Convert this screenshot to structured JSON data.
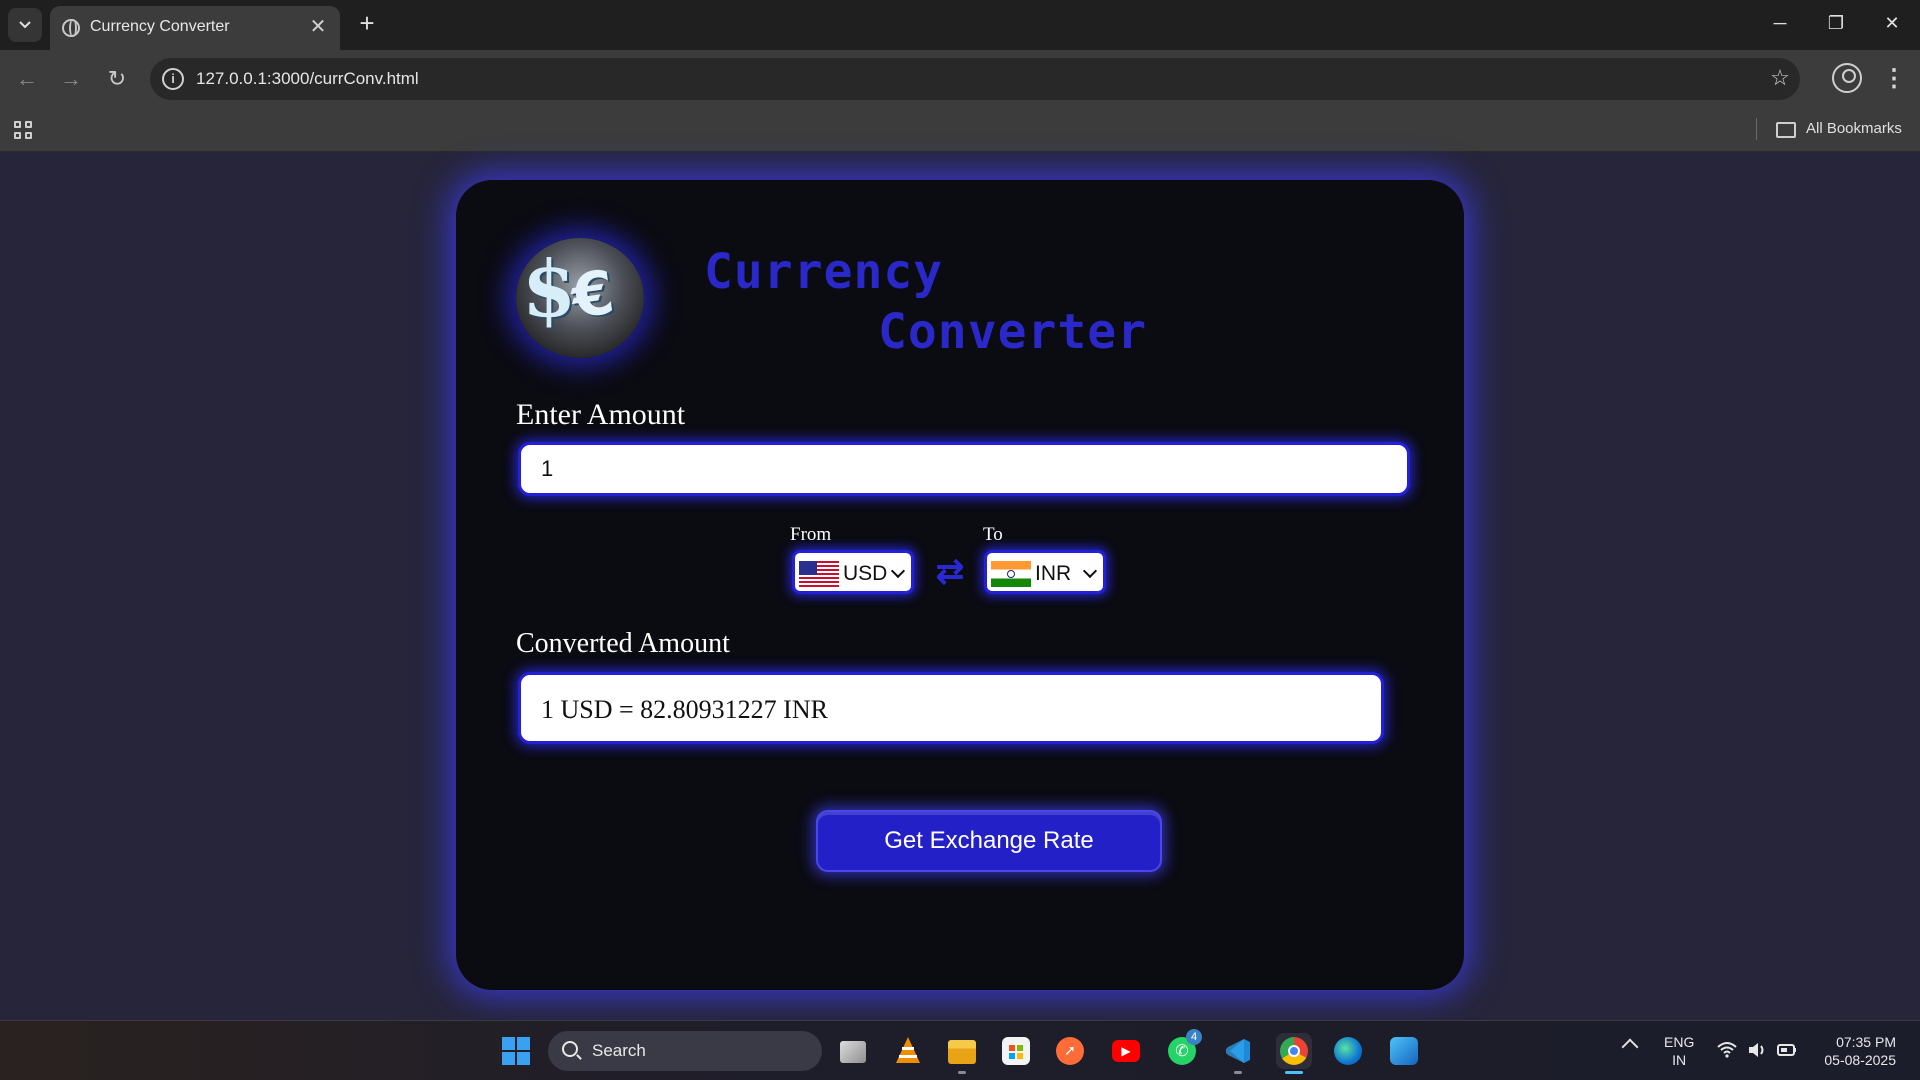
{
  "browser": {
    "tab_title": "Currency Converter",
    "url": "127.0.0.1:3000/currConv.html",
    "bookmarks_label": "All Bookmarks"
  },
  "page": {
    "title_line1": "Currency",
    "title_line2": "Converter",
    "amount_label": "Enter Amount",
    "amount_value": "1",
    "from_label": "From",
    "to_label": "To",
    "from_currency": "USD",
    "to_currency": "INR",
    "converted_label": "Converted Amount",
    "converted_text": "1 USD = 82.80931227 INR",
    "button_label": "Get Exchange Rate",
    "accent_color": "#2320c8"
  },
  "taskbar": {
    "search_label": "Search",
    "whatsapp_badge": "4",
    "lang_line1": "ENG",
    "lang_line2": "IN",
    "time": "07:35 PM",
    "date": "05-08-2025"
  }
}
